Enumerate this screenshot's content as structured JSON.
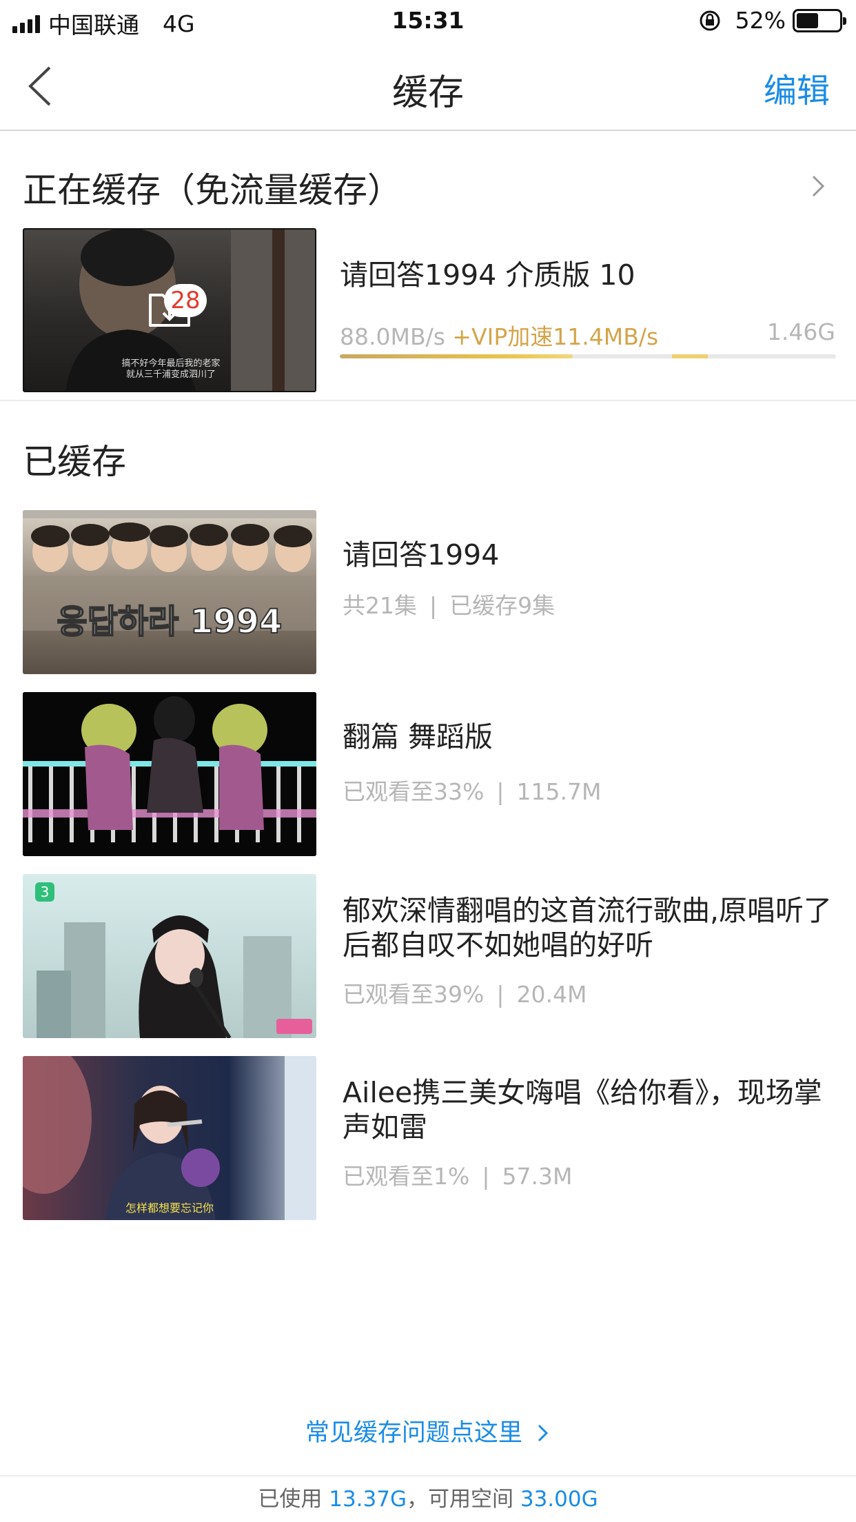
{
  "status_bar": {
    "carrier": "中国联通",
    "network": "4G",
    "time": "15:31",
    "battery_text": "52%",
    "battery_level": 0.52
  },
  "nav": {
    "title": "缓存",
    "edit_label": "编辑"
  },
  "downloading": {
    "section_title": "正在缓存（免流量缓存）",
    "badge_count": "28",
    "thumb_caption_line1": "搞不好今年最后我的老家",
    "thumb_caption_line2": "就从三千浦变成泗川了",
    "item": {
      "title": "请回答1994 介质版 10",
      "speed": "88.0MB/s",
      "vip_speed": "+VIP加速11.4MB/s",
      "size": "1.46G",
      "progress": 0.47,
      "vip_progress": 0.12
    }
  },
  "downloaded": {
    "section_title": "已缓存",
    "items": [
      {
        "title": "请回答1994",
        "meta_left": "共21集",
        "meta_right": "已缓存9集",
        "thumb_text": "응답하라 1994"
      },
      {
        "title": "翻篇 舞蹈版",
        "meta_left": "已观看至33%",
        "meta_right": "115.7M"
      },
      {
        "title": "郁欢深情翻唱的这首流行歌曲,原唱听了后都自叹不如她唱的好听",
        "meta_left": "已观看至39%",
        "meta_right": "20.4M"
      },
      {
        "title": "Ailee携三美女嗨唱《给你看》，现场掌声如雷",
        "meta_left": "已观看至1%",
        "meta_right": "57.3M",
        "thumb_caption": "怎样都想要忘记你"
      }
    ]
  },
  "help_link": "常见缓存问题点这里",
  "footer": {
    "used_label": "已使用",
    "used_value": "13.37G",
    "available_label": "，可用空间",
    "available_value": "33.00G"
  },
  "colors": {
    "accent_blue": "#1a8ce6",
    "vip_gold": "#d4a44a",
    "badge_red": "#e23b2e"
  }
}
